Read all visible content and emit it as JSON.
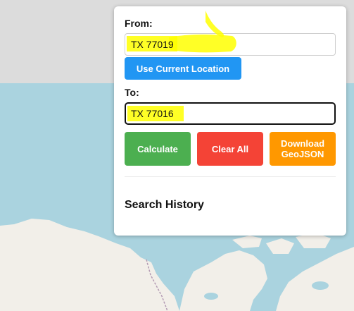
{
  "from": {
    "label": "From:",
    "value": "TX 77019"
  },
  "location_button": "Use Current Location",
  "to": {
    "label": "To:",
    "value": "TX 77016"
  },
  "buttons": {
    "calculate": "Calculate",
    "clear": "Clear All",
    "download_line1": "Download",
    "download_line2": "GeoJSON"
  },
  "history": {
    "title": "Search History"
  },
  "colors": {
    "calculate": "#4caf50",
    "clear": "#f44336",
    "download": "#ff9800",
    "location": "#2196f3",
    "highlight": "#ffff00",
    "land": "#f2efe9",
    "water": "#aad3df"
  }
}
